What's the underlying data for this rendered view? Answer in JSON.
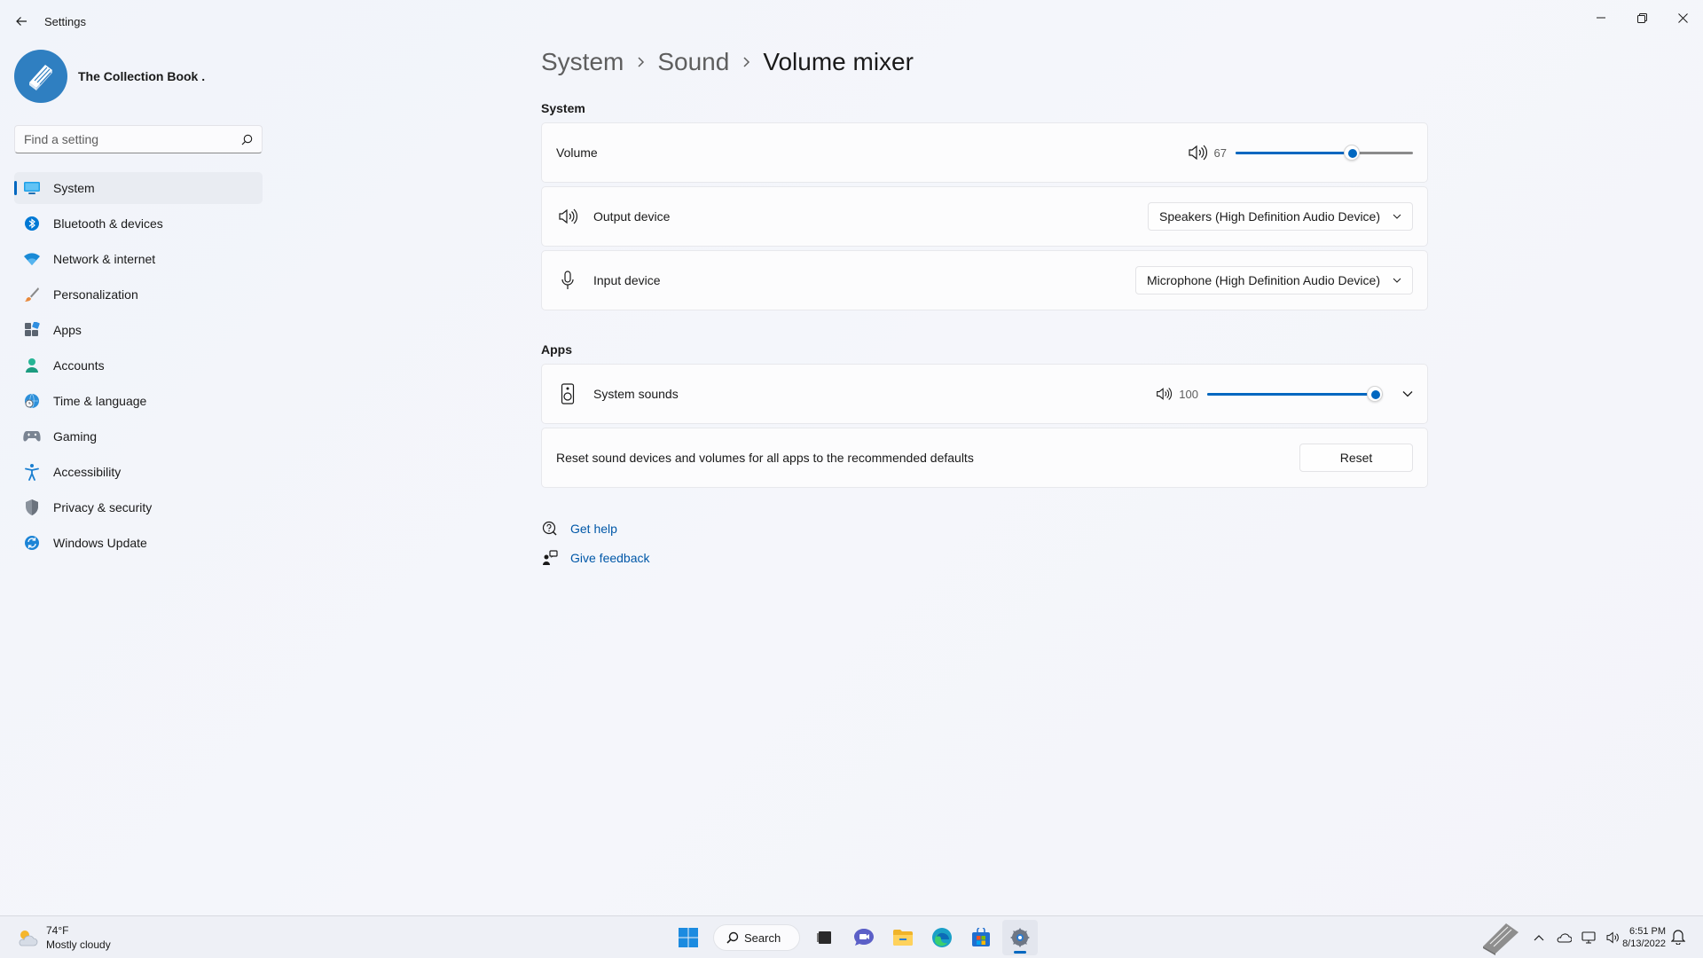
{
  "window": {
    "app_title": "Settings"
  },
  "profile": {
    "name": "The Collection Book ."
  },
  "search": {
    "placeholder": "Find a setting"
  },
  "sidebar": {
    "items": [
      {
        "label": "System",
        "icon": "monitor-icon",
        "active": true
      },
      {
        "label": "Bluetooth & devices",
        "icon": "bluetooth-icon"
      },
      {
        "label": "Network & internet",
        "icon": "wifi-icon"
      },
      {
        "label": "Personalization",
        "icon": "brush-icon"
      },
      {
        "label": "Apps",
        "icon": "apps-icon"
      },
      {
        "label": "Accounts",
        "icon": "person-icon"
      },
      {
        "label": "Time & language",
        "icon": "globe-clock-icon"
      },
      {
        "label": "Gaming",
        "icon": "gamepad-icon"
      },
      {
        "label": "Accessibility",
        "icon": "accessibility-icon"
      },
      {
        "label": "Privacy & security",
        "icon": "shield-icon"
      },
      {
        "label": "Windows Update",
        "icon": "update-icon"
      }
    ]
  },
  "breadcrumb": {
    "items": [
      "System",
      "Sound"
    ],
    "current": "Volume mixer"
  },
  "system_section": {
    "heading": "System",
    "volume": {
      "label": "Volume",
      "value": "67",
      "percent": 67
    },
    "output": {
      "label": "Output device",
      "selected": "Speakers (High Definition Audio Device)"
    },
    "input": {
      "label": "Input device",
      "selected": "Microphone (High Definition Audio Device)"
    }
  },
  "apps_section": {
    "heading": "Apps",
    "system_sounds": {
      "label": "System sounds",
      "value": "100",
      "percent": 100
    },
    "reset": {
      "text": "Reset sound devices and volumes for all apps to the recommended defaults",
      "button": "Reset"
    }
  },
  "links": {
    "help": "Get help",
    "feedback": "Give feedback"
  },
  "taskbar": {
    "weather_temp": "74°F",
    "weather_desc": "Mostly cloudy",
    "search_label": "Search",
    "time": "6:51 PM",
    "date": "8/13/2022"
  },
  "colors": {
    "accent": "#0067c0",
    "link": "#0058a8"
  }
}
